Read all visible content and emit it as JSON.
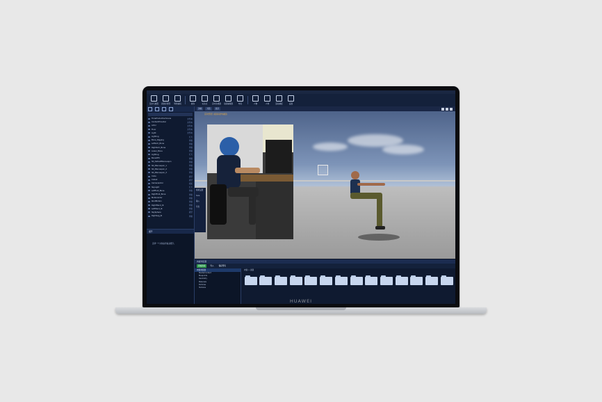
{
  "brand": "HUAWEI",
  "menubar": {
    "items": [
      "文件",
      "编辑",
      "帮助"
    ]
  },
  "toolbar": {
    "tools": [
      "显示与放置",
      "资源库管理",
      "场景编辑",
      "属性",
      "标注点",
      "实时生成器",
      "动画编辑器",
      "布局",
      "人物",
      "人体",
      "运动捕捉",
      "设置"
    ]
  },
  "left_panel": {
    "tree": [
      {
        "name": "TimeProductionScene",
        "type": "文件夹"
      },
      {
        "name": "ContentProvider",
        "type": "文件夹"
      },
      {
        "name": "Actor",
        "type": "文件夹"
      },
      {
        "name": "Floor",
        "type": "文件夹"
      },
      {
        "name": "Light",
        "type": "文件夹"
      },
      {
        "name": "Lighting",
        "type": "灯光"
      },
      {
        "name": "Bone_Rigging",
        "type": "骨骼"
      },
      {
        "name": "LeftArm_Bone",
        "type": "骨骼"
      },
      {
        "name": "RightArm_Bone",
        "type": "骨骼"
      },
      {
        "name": "Lower_Bone",
        "type": "骨骼"
      },
      {
        "name": "Lighting",
        "type": "灯光"
      },
      {
        "name": "BoneDFX",
        "type": "骨骼"
      },
      {
        "name": "SK_DefaultMannequin",
        "type": "骨骼"
      },
      {
        "name": "SK_Mannequin_1",
        "type": "骨骼"
      },
      {
        "name": "SK_Mannequin_2",
        "type": "骨骼"
      },
      {
        "name": "SK_Mannequin_3",
        "type": "骨骼"
      },
      {
        "name": "Cube",
        "type": "模型"
      },
      {
        "name": "Cube2",
        "type": "模型"
      },
      {
        "name": "CameraActor",
        "type": "相机"
      },
      {
        "name": "SkyLight",
        "type": "灯光"
      },
      {
        "name": "LeftFoot_Bone",
        "type": "骨骼"
      },
      {
        "name": "RightFoot_Bone",
        "type": "骨骼"
      },
      {
        "name": "MotionActor",
        "type": "骨骼"
      },
      {
        "name": "RootMotion",
        "type": "骨骼"
      },
      {
        "name": "RightHand_IK",
        "type": "骨骼"
      },
      {
        "name": "LeftHand_IK",
        "type": "骨骼"
      },
      {
        "name": "SkySphere",
        "type": "模型"
      },
      {
        "name": "RightLeg_IK",
        "type": "骨骼"
      }
    ],
    "detail_title": "细节",
    "detail_text": "选择一个对象来查看其细节。",
    "outliner_title": "场景大纲"
  },
  "viewport": {
    "tabs": [
      "透视",
      "光照",
      "显示"
    ],
    "title": "实时预览 (模拟动作捕捉)",
    "mini_menu": [
      "相机设置",
      "Size",
      "输入",
      "导出"
    ]
  },
  "bottom_panel": {
    "title": "内容浏览器",
    "buttons": [
      "添加新项",
      "导入",
      "保存所有"
    ],
    "left_header": "内容浏览器",
    "left_items": [
      "StarterContent",
      "Blueprints",
      "Geometry",
      "Materials",
      "Particles",
      "Textures"
    ],
    "crumbs": "内容 > 资源",
    "folder_count": 14
  },
  "colors": {
    "accent": "#2f9a4a",
    "panel": "#0f1a30",
    "title": "#d6a24a"
  }
}
